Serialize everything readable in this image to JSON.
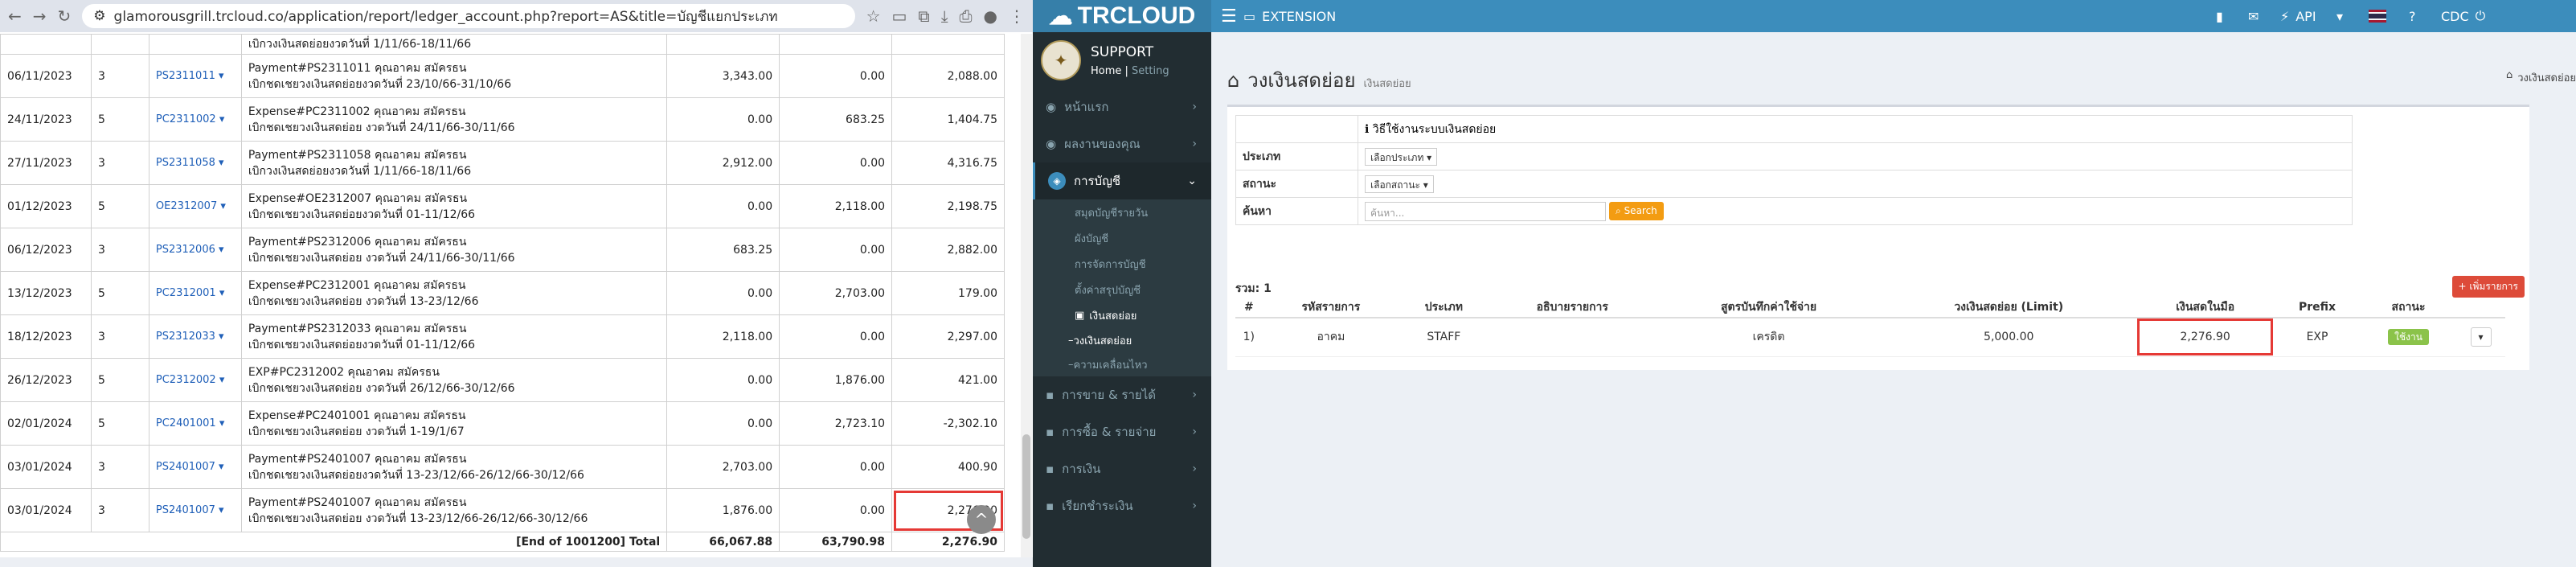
{
  "browser": {
    "url": "glamorousgrill.trcloud.co/application/report/ledger_account.php?report=AS&title=บัญชีแยกประเภท"
  },
  "ledger": {
    "first_row_desc": "เบิกวงเงินสดย่อยงวดวันที่ 1/11/66-18/11/66",
    "rows": [
      {
        "date": "06/11/2023",
        "type": "3",
        "ref": "PS2311011",
        "desc1": "Payment#PS2311011 คุณอาคม สมัครธน",
        "desc2": "เบิกชดเชยวงเงินสดย่อยงวดวันที่ 23/10/66-31/10/66",
        "debit": "3,343.00",
        "credit": "0.00",
        "balance": "2,088.00"
      },
      {
        "date": "24/11/2023",
        "type": "5",
        "ref": "PC2311002",
        "desc1": "Expense#PC2311002 คุณอาคม สมัครธน",
        "desc2": "เบิกชดเชยวงเงินสดย่อย งวดวันที่ 24/11/66-30/11/66",
        "debit": "0.00",
        "credit": "683.25",
        "balance": "1,404.75"
      },
      {
        "date": "27/11/2023",
        "type": "3",
        "ref": "PS2311058",
        "desc1": "Payment#PS2311058 คุณอาคม สมัครธน",
        "desc2": "เบิกวงเงินสดย่อยงวดวันที่ 1/11/66-18/11/66",
        "debit": "2,912.00",
        "credit": "0.00",
        "balance": "4,316.75"
      },
      {
        "date": "01/12/2023",
        "type": "5",
        "ref": "OE2312007",
        "desc1": "Expense#OE2312007 คุณอาคม สมัครธน",
        "desc2": "เบิกชดเชยวงเงินสดย่อยงวดวันที่ 01-11/12/66",
        "debit": "0.00",
        "credit": "2,118.00",
        "balance": "2,198.75"
      },
      {
        "date": "06/12/2023",
        "type": "3",
        "ref": "PS2312006",
        "desc1": "Payment#PS2312006 คุณอาคม สมัครธน",
        "desc2": "เบิกชดเชยวงเงินสดย่อย งวดวันที่ 24/11/66-30/11/66",
        "debit": "683.25",
        "credit": "0.00",
        "balance": "2,882.00"
      },
      {
        "date": "13/12/2023",
        "type": "5",
        "ref": "PC2312001",
        "desc1": "Expense#PC2312001 คุณอาคม สมัครธน",
        "desc2": "เบิกชดเชยวงเงินสดย่อย งวดวันที่ 13-23/12/66",
        "debit": "0.00",
        "credit": "2,703.00",
        "balance": "179.00"
      },
      {
        "date": "18/12/2023",
        "type": "3",
        "ref": "PS2312033",
        "desc1": "Payment#PS2312033 คุณอาคม สมัครธน",
        "desc2": "เบิกชดเชยวงเงินสดย่อยงวดวันที่ 01-11/12/66",
        "debit": "2,118.00",
        "credit": "0.00",
        "balance": "2,297.00"
      },
      {
        "date": "26/12/2023",
        "type": "5",
        "ref": "PC2312002",
        "desc1": "EXP#PC2312002 คุณอาคม สมัครธน",
        "desc2": "เบิกชดเชยวงเงินสดย่อย งวดวันที่ 26/12/66-30/12/66",
        "debit": "0.00",
        "credit": "1,876.00",
        "balance": "421.00"
      },
      {
        "date": "02/01/2024",
        "type": "5",
        "ref": "PC2401001",
        "desc1": "Expense#PC2401001 คุณอาคม สมัครธน",
        "desc2": "เบิกชดเชยวงเงินสดย่อย งวดวันที่ 1-19/1/67",
        "debit": "0.00",
        "credit": "2,723.10",
        "balance": "-2,302.10"
      },
      {
        "date": "03/01/2024",
        "type": "3",
        "ref": "PS2401007",
        "desc1": "Payment#PS2401007 คุณอาคม สมัครธน",
        "desc2": "เบิกชดเชยวงเงินสดย่อยงวดวันที่ 13-23/12/66-26/12/66-30/12/66",
        "debit": "2,703.00",
        "credit": "0.00",
        "balance": "400.90"
      },
      {
        "date": "03/01/2024",
        "type": "3",
        "ref": "PS2401007",
        "desc1": "Payment#PS2401007 คุณอาคม สมัครธน",
        "desc2": "เบิกชดเชยวงเงินสดย่อย งวดวันที่ 13-23/12/66-26/12/66-30/12/66",
        "debit": "1,876.00",
        "credit": "0.00",
        "balance": "2,276.90"
      }
    ],
    "total_label": "[End of 1001200] Total",
    "total_debit": "66,067.88",
    "total_credit": "63,790.98",
    "total_balance": "2,276.90"
  },
  "trcloud": {
    "logo": "TRCLOUD",
    "user_name": "SUPPORT",
    "home_link": "Home",
    "setting_link": "Setting",
    "menu": [
      {
        "label": "หน้าแรก",
        "icon": "home-icon"
      },
      {
        "label": "ผลงานของคุณ",
        "icon": "chart-icon"
      },
      {
        "label": "การบัญชี",
        "icon": "book-icon",
        "active": true
      }
    ],
    "submenu": [
      "สมุดบัญชีรายวัน",
      "ผังบัญชี",
      "การจัดการบัญชี",
      "ตั้งค่าสรุปบัญชี"
    ],
    "submenu_current": "เงินสดย่อย",
    "subsub": [
      "วงเงินสดย่อย",
      "ความเคลื่อนไหว"
    ],
    "menu_bottom": [
      "การขาย & รายได้",
      "การซื้อ & รายจ่าย",
      "การเงิน",
      "เรียกชำระเงิน"
    ],
    "topbar": {
      "extension": "EXTENSION",
      "api": "API",
      "company": "CDC"
    },
    "page_title": "วงเงินสดย่อย",
    "page_subtitle": "เงินสดย่อย",
    "breadcrumb": "วงเงินสดย่อย",
    "help_link": "วิธีใช้งานระบบเงินสดย่อย",
    "filter_type_label": "ประเภท",
    "filter_type_value": "เลือกประเภท",
    "filter_status_label": "สถานะ",
    "filter_status_value": "เลือกสถานะ",
    "search_label": "ค้นหา",
    "search_placeholder": "ค้นหา...",
    "search_button": "Search",
    "count_label": "รวม: 1",
    "add_button": "+ เพิ่มรายการ",
    "columns": [
      "#",
      "รหัสรายการ",
      "ประเภท",
      "อธิบายรายการ",
      "สูตรบันทึกค่าใช้จ่าย",
      "วงเงินสดย่อย (Limit)",
      "เงินสดในมือ",
      "Prefix",
      "สถานะ"
    ],
    "rows": [
      {
        "no": "1)",
        "code": "อาคม",
        "type": "STAFF",
        "desc": "",
        "formula": "เครดิต",
        "limit": "5,000.00",
        "cash": "2,276.90",
        "prefix": "EXP",
        "status": "ใช้งาน"
      }
    ]
  }
}
